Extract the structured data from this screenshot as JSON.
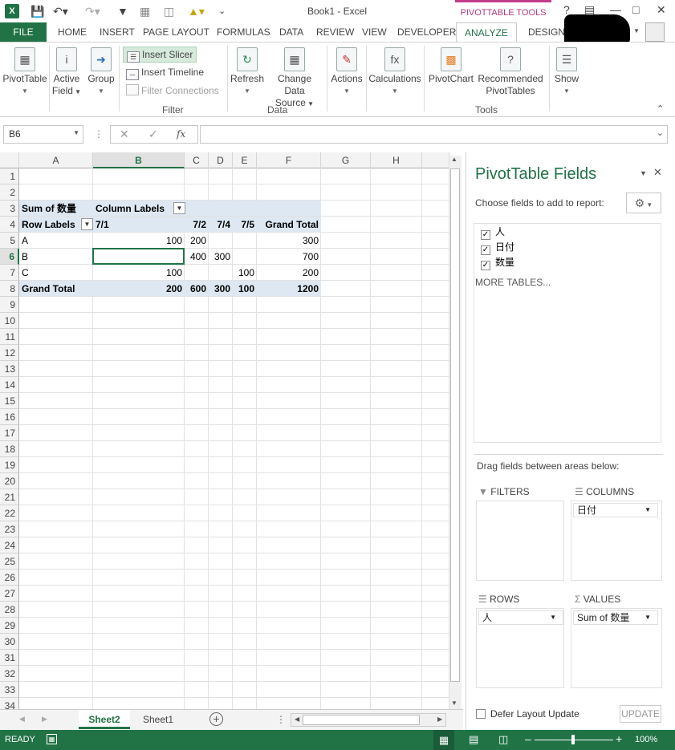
{
  "title_bar": {
    "app_title": "Book1 - Excel",
    "contextual_tab": "PIVOTTABLE TOOLS",
    "help": "?"
  },
  "tabs": [
    "FILE",
    "HOME",
    "INSERT",
    "PAGE LAYOUT",
    "FORMULAS",
    "DATA",
    "REVIEW",
    "VIEW",
    "DEVELOPER",
    "ANALYZE",
    "DESIGN"
  ],
  "ribbon": {
    "pivottable": "PivotTable",
    "active_field_1": "Active",
    "active_field_2": "Field",
    "group": "Group",
    "insert_slicer": "Insert Slicer",
    "insert_timeline": "Insert Timeline",
    "filter_connections": "Filter Connections",
    "filter_group": "Filter",
    "refresh": "Refresh",
    "change_data_1": "Change Data",
    "change_data_2": "Source",
    "data_group": "Data",
    "actions": "Actions",
    "calculations": "Calculations",
    "pivotchart": "PivotChart",
    "recommended_1": "Recommended",
    "recommended_2": "PivotTables",
    "tools_group": "Tools",
    "show": "Show"
  },
  "formula_bar": {
    "name_box": "B6",
    "fx": "fx",
    "formula": ""
  },
  "columns": [
    "A",
    "B",
    "C",
    "D",
    "E",
    "F",
    "G",
    "H"
  ],
  "rows": [
    "1",
    "2",
    "3",
    "4",
    "5",
    "6",
    "7",
    "8",
    "9",
    "10",
    "11",
    "12",
    "13",
    "14",
    "15",
    "16",
    "17",
    "18",
    "19",
    "20",
    "21",
    "22",
    "23",
    "24",
    "25",
    "26",
    "27",
    "28",
    "29",
    "30",
    "31",
    "32",
    "33",
    "34"
  ],
  "pivot": {
    "sum_label": "Sum of 数量",
    "column_labels": "Column Labels",
    "row_labels": "Row Labels",
    "col_headers": [
      "7/1",
      "7/2",
      "7/4",
      "7/5",
      "Grand Total"
    ],
    "rows": [
      {
        "label": "A",
        "values": [
          "100",
          "200",
          "",
          "",
          "300"
        ]
      },
      {
        "label": "B",
        "values": [
          "",
          "400",
          "300",
          "",
          "700"
        ]
      },
      {
        "label": "C",
        "values": [
          "100",
          "",
          "",
          "100",
          "200"
        ]
      }
    ],
    "grand_total_label": "Grand Total",
    "grand_total": [
      "200",
      "600",
      "300",
      "100",
      "1200"
    ]
  },
  "sheets": {
    "active": "Sheet2",
    "other": "Sheet1"
  },
  "panel": {
    "title": "PivotTable Fields",
    "choose": "Choose fields to add to report:",
    "fields": [
      "人",
      "日付",
      "数量"
    ],
    "more_tables": "MORE TABLES...",
    "drag": "Drag fields between areas below:",
    "filters": "FILTERS",
    "columns": "COLUMNS",
    "rows": "ROWS",
    "values": "VALUES",
    "columns_item": "日付",
    "rows_item": "人",
    "values_item": "Sum of 数量",
    "defer": "Defer Layout Update",
    "update": "UPDATE"
  },
  "status": {
    "ready": "READY",
    "zoom": "100%"
  }
}
